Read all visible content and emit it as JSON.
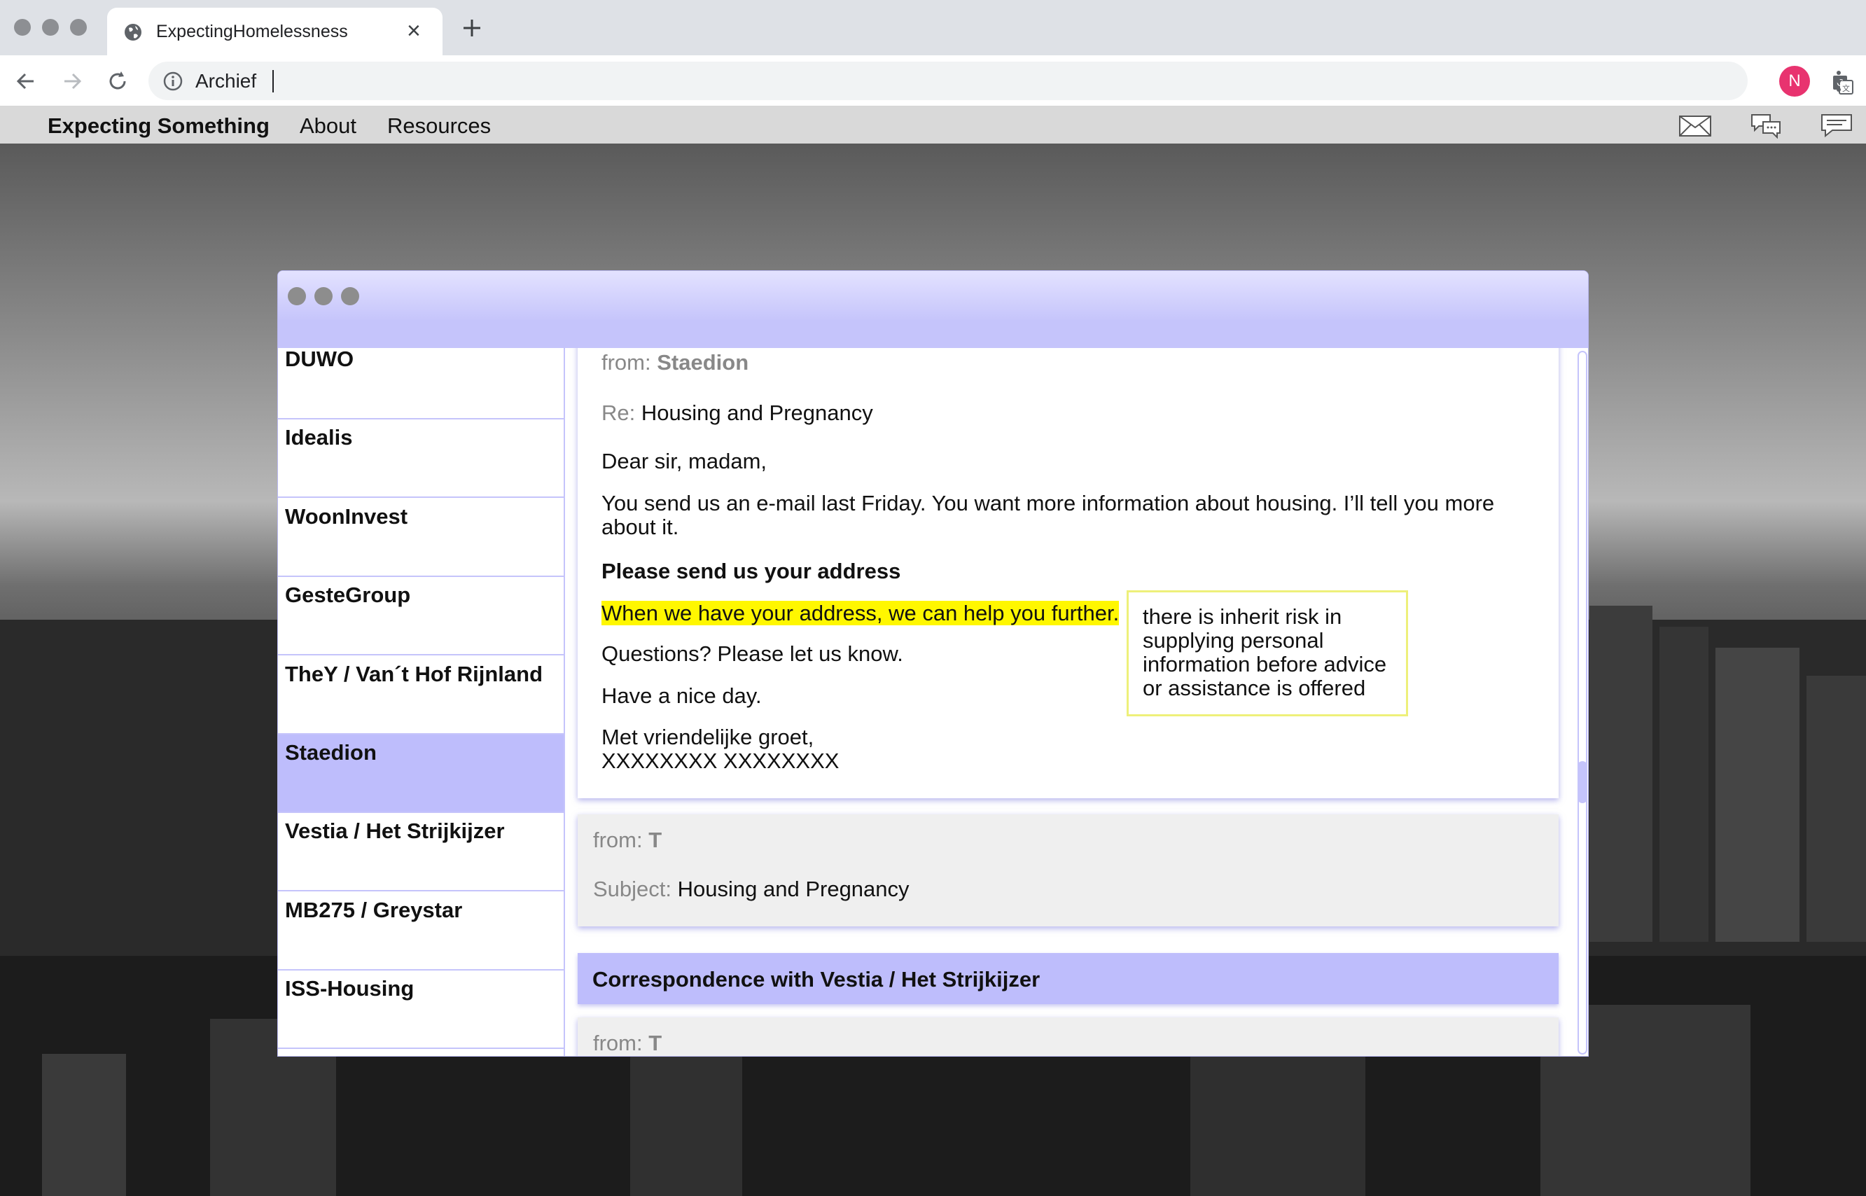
{
  "browser": {
    "tab_title": "ExpectingHomelessness",
    "url": "Archief",
    "avatar_letter": "N"
  },
  "site": {
    "brand": "Expecting Something",
    "nav": [
      "About",
      "Resources"
    ]
  },
  "sidebar": {
    "items": [
      {
        "label": "DUWO",
        "active": false
      },
      {
        "label": "Idealis",
        "active": false
      },
      {
        "label": "WoonInvest",
        "active": false
      },
      {
        "label": "GesteGroup",
        "active": false
      },
      {
        "label": "TheY / Van´t Hof Rijnland",
        "active": false
      },
      {
        "label": "Staedion",
        "active": true
      },
      {
        "label": "Vestia / Het Strijkijzer",
        "active": false
      },
      {
        "label": "MB275 / Greystar",
        "active": false
      },
      {
        "label": "ISS-Housing",
        "active": false
      }
    ]
  },
  "message1": {
    "from_label": "from:",
    "from": "Staedion",
    "re_label": "Re:",
    "subject": "Housing and Pregnancy",
    "greeting": "Dear sir, madam,",
    "body1_line1": "You send us an e-mail last Friday. You want more information about housing. I’ll tell you more",
    "body1_line2": "about it.",
    "bold_line": "Please send us your address",
    "highlight": "When we have your address, we can help you further.",
    "questions": "Questions? Please let us know.",
    "nice_day": "Have a nice day.",
    "closing": "Met vriendelijke groet,",
    "signature": "XXXXXXXX XXXXXXXX"
  },
  "note": {
    "lines": [
      "there is inherit risk in",
      "supplying personal",
      "information before advice",
      "or assistance is offered"
    ]
  },
  "message2": {
    "from_label": "from:",
    "from": "T",
    "subject_label": "Subject:",
    "subject": "Housing and Pregnancy"
  },
  "section": {
    "title": "Correspondence with Vestia / Het Strijkijzer"
  },
  "message3": {
    "from_label": "from:",
    "from": "T"
  },
  "colors": {
    "accent": "#bebdfc",
    "highlight": "#fff700",
    "avatar": "#e8336f"
  }
}
